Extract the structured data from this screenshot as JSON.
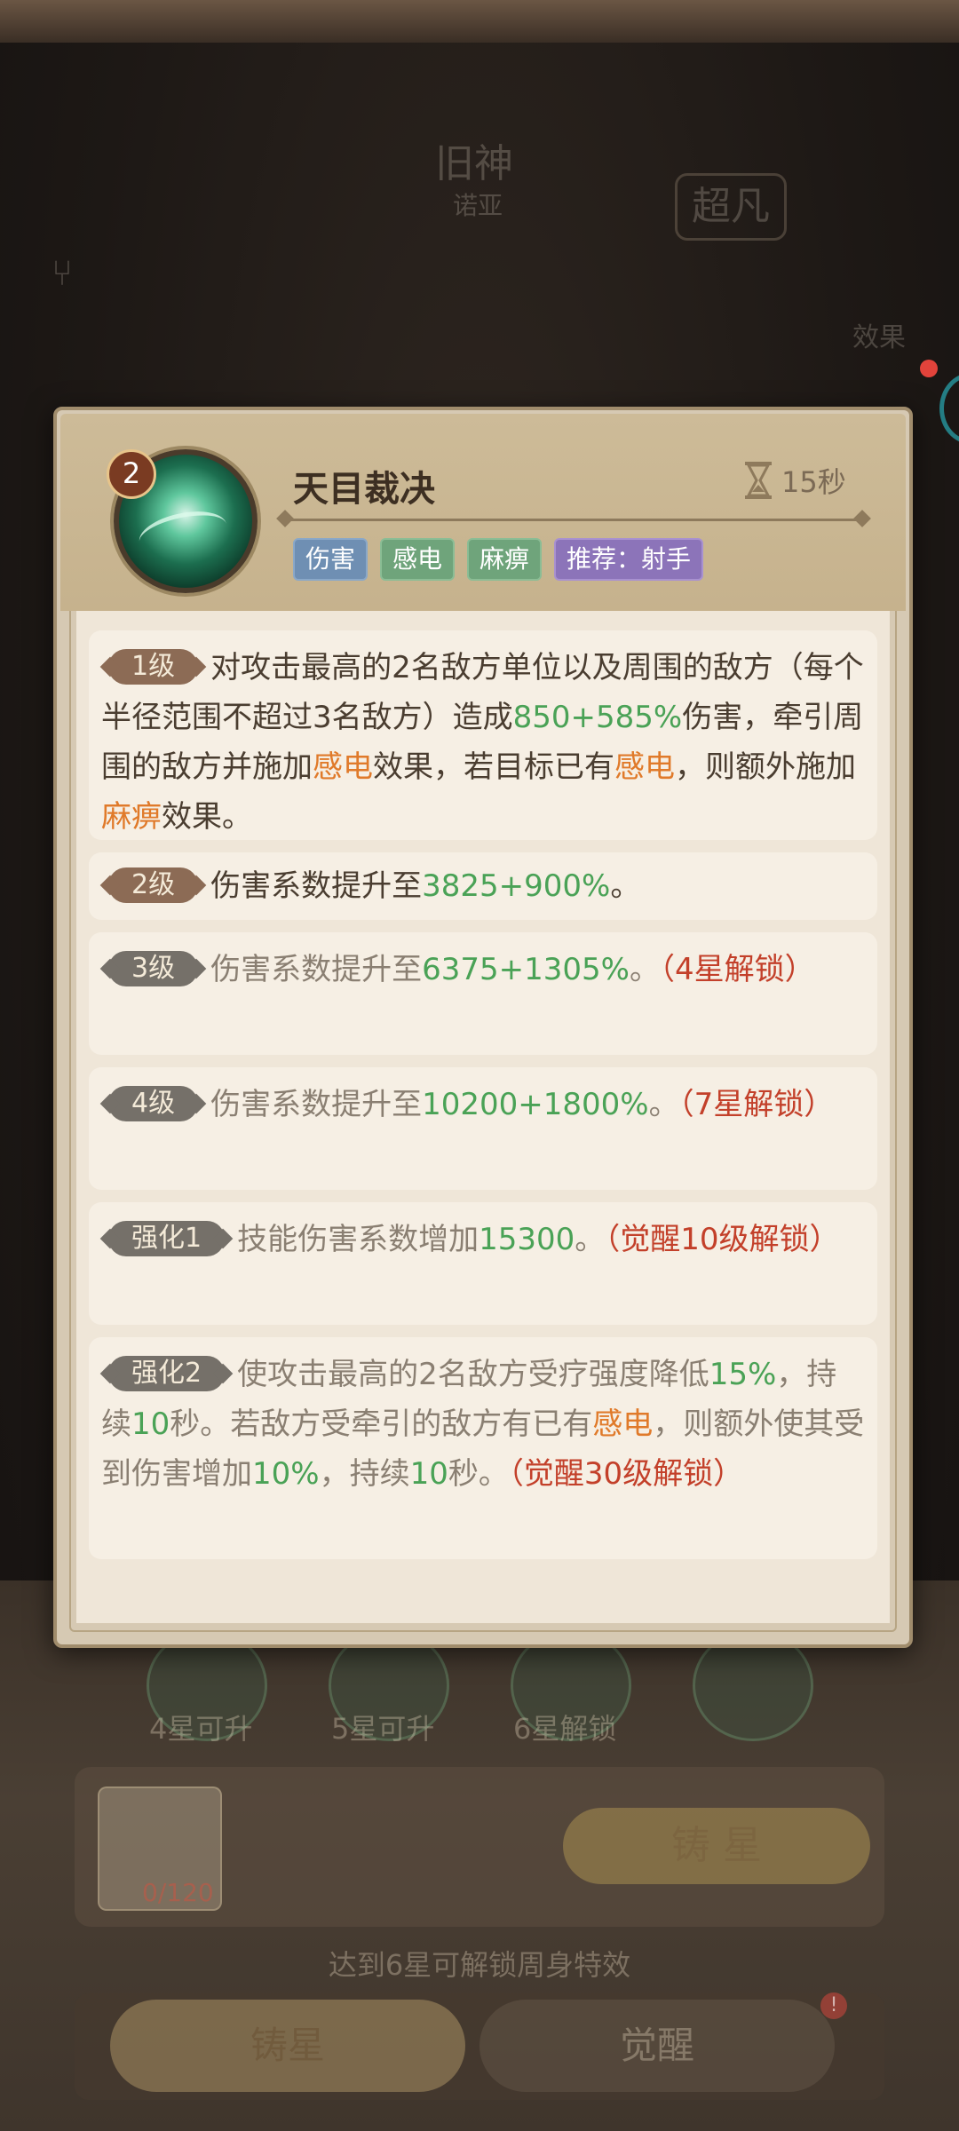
{
  "background": {
    "hero_title": "旧神",
    "hero_subtitle": "诺亚",
    "hero_stamp": "超凡",
    "effect_label": "效果",
    "skill_levels": [
      {
        "label": "4星可升"
      },
      {
        "label": "5星可升"
      },
      {
        "label": "6星解锁"
      }
    ],
    "item_count": "0/120",
    "forge_button": "铸 星",
    "hint": "达到6星可解锁周身特效",
    "tabs": [
      {
        "label": "铸星"
      },
      {
        "label": "觉醒"
      }
    ],
    "tab_badge": "!"
  },
  "skill": {
    "level_badge": "2",
    "name": "天目裁决",
    "cooldown": "15秒",
    "tags": [
      "伤害",
      "感电",
      "麻痹",
      "推荐：射手"
    ],
    "entries": [
      {
        "pill": "1级",
        "segments": [
          {
            "t": "对攻击最高的2名敌方单位以及周围的敌方（每个半径范围不超过3名敌方）造成"
          },
          {
            "t": "850+585%"
          },
          {
            "t": "伤害，牵引周围的敌方并施加"
          },
          {
            "t": "感电"
          },
          {
            "t": "效果，若目标已有"
          },
          {
            "t": "感电"
          },
          {
            "t": "，则额外施加"
          },
          {
            "t": "麻痹"
          },
          {
            "t": "效果。"
          }
        ]
      },
      {
        "pill": "2级",
        "segments": [
          {
            "t": "伤害系数提升至"
          },
          {
            "t": "3825+900%"
          },
          {
            "t": "。"
          }
        ]
      },
      {
        "pill": "3级",
        "segments": [
          {
            "t": "伤害系数提升至"
          },
          {
            "t": "6375+1305%"
          },
          {
            "t": "。"
          },
          {
            "t": "（4星解锁）"
          }
        ]
      },
      {
        "pill": "4级",
        "segments": [
          {
            "t": "伤害系数提升至"
          },
          {
            "t": "10200+1800%"
          },
          {
            "t": "。"
          },
          {
            "t": "（7星解锁）"
          }
        ]
      },
      {
        "pill": "强化1",
        "segments": [
          {
            "t": "技能伤害系数增加"
          },
          {
            "t": "15300"
          },
          {
            "t": "。"
          },
          {
            "t": "（觉醒10级解锁）"
          }
        ]
      },
      {
        "pill": "强化2",
        "segments": [
          {
            "t": "使攻击最高的2名敌方受疗强度降低"
          },
          {
            "t": "15%"
          },
          {
            "t": "，持续"
          },
          {
            "t": "10"
          },
          {
            "t": "秒。若敌方受牵引的敌方有已有"
          },
          {
            "t": "感电"
          },
          {
            "t": "，则额外使其受到伤害增加"
          },
          {
            "t": "10%"
          },
          {
            "t": "，持续"
          },
          {
            "t": "10"
          },
          {
            "t": "秒。"
          },
          {
            "t": "（觉醒30级解锁）"
          }
        ]
      }
    ]
  },
  "colors": {
    "number_green": "#4aa256",
    "keyword_orange": "#e07a2a",
    "unlock_red": "#c3402a"
  }
}
